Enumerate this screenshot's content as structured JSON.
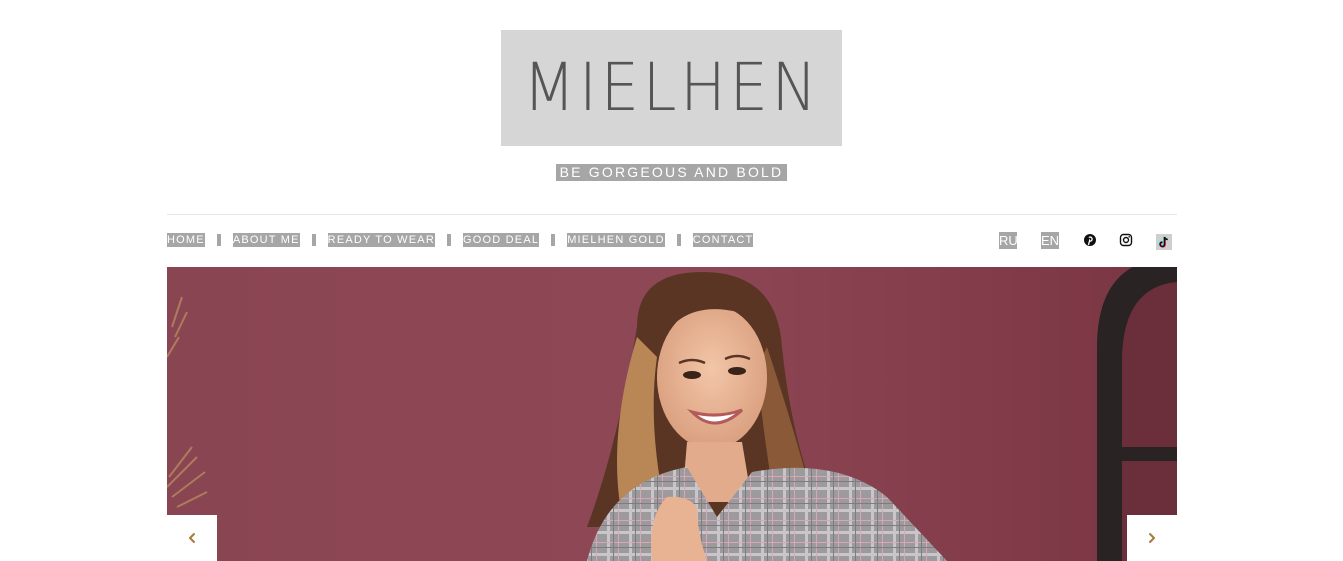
{
  "header": {
    "logo_text": "MIELHEN",
    "tagline": "BE GORGEOUS AND BOLD"
  },
  "nav": {
    "items": [
      {
        "label": "HOME"
      },
      {
        "label": "ABOUT ME"
      },
      {
        "label": "READY TO WEAR"
      },
      {
        "label": "GOOD DEAL"
      },
      {
        "label": "MIELHEN GOLD"
      },
      {
        "label": "CONTACT"
      }
    ]
  },
  "languages": [
    {
      "label": "RU"
    },
    {
      "label": "EN"
    }
  ],
  "social": [
    {
      "icon": "pinterest-icon"
    },
    {
      "icon": "instagram-icon"
    },
    {
      "icon": "tiktok-icon"
    }
  ],
  "slider": {
    "prev_icon": "chevron-left-icon",
    "next_icon": "chevron-right-icon"
  },
  "colors": {
    "logo_bg": "#d6d6d6",
    "highlight": "#a6a6a6",
    "hero_wall": "#853f4d",
    "arrow": "#a57a3a"
  }
}
